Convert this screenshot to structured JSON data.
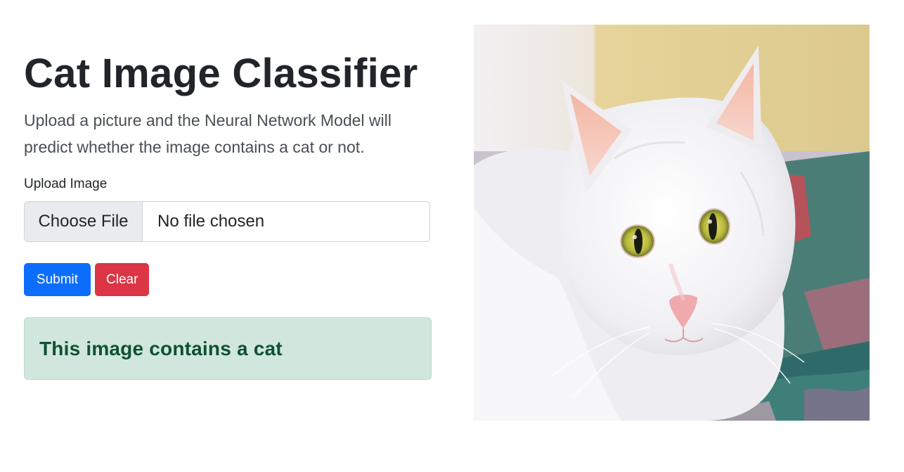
{
  "page": {
    "title": "Cat Image Classifier",
    "description": "Upload a picture and the Neural Network Model will predict whether the image contains a cat or not."
  },
  "form": {
    "label": "Upload Image",
    "choose_file_label": "Choose File",
    "file_status": "No file chosen"
  },
  "buttons": {
    "submit_label": "Submit",
    "clear_label": "Clear"
  },
  "result": {
    "message": "This image contains a cat"
  },
  "colors": {
    "primary": "#0d6efd",
    "danger": "#dc3545",
    "success_bg": "#d1e7dd",
    "success_text": "#0f5132"
  },
  "image": {
    "subject": "white cat with green-yellow eyes lying on a blanket"
  }
}
